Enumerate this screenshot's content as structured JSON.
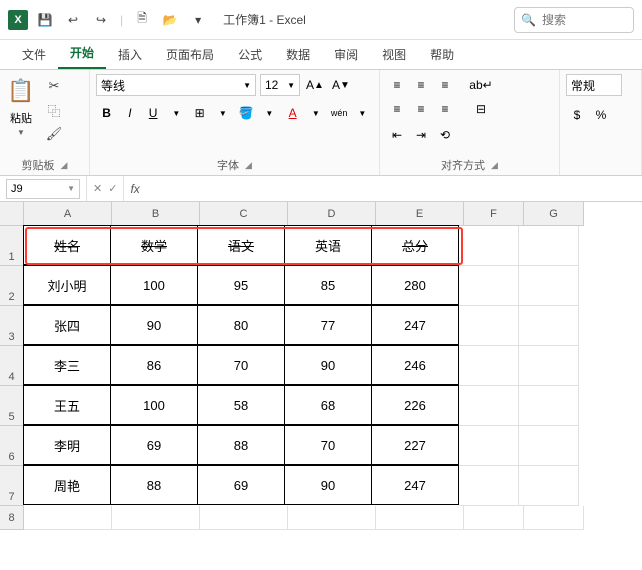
{
  "titlebar": {
    "title": "工作簿1 - Excel",
    "search_placeholder": "搜索"
  },
  "tabs": [
    "文件",
    "开始",
    "插入",
    "页面布局",
    "公式",
    "数据",
    "审阅",
    "视图",
    "帮助"
  ],
  "active_tab": 1,
  "ribbon": {
    "clipboard": {
      "paste": "粘贴",
      "label": "剪贴板"
    },
    "font": {
      "name": "等线",
      "size": "12",
      "label": "字体"
    },
    "align": {
      "label": "对齐方式"
    },
    "number": {
      "format": "常规"
    }
  },
  "name_box": "J9",
  "columns": [
    "A",
    "B",
    "C",
    "D",
    "E",
    "F",
    "G"
  ],
  "rows": [
    "1",
    "2",
    "3",
    "4",
    "5",
    "6",
    "7",
    "8"
  ],
  "table": {
    "headers": [
      "姓名",
      "数学",
      "语文",
      "英语",
      "总分"
    ],
    "data": [
      [
        "刘小明",
        "100",
        "95",
        "85",
        "280"
      ],
      [
        "张四",
        "90",
        "80",
        "77",
        "247"
      ],
      [
        "李三",
        "86",
        "70",
        "90",
        "246"
      ],
      [
        "王五",
        "100",
        "58",
        "68",
        "226"
      ],
      [
        "李明",
        "69",
        "88",
        "70",
        "227"
      ],
      [
        "周艳",
        "88",
        "69",
        "90",
        "247"
      ]
    ]
  },
  "chart_data": {
    "type": "table",
    "columns": [
      "姓名",
      "数学",
      "语文",
      "英语",
      "总分"
    ],
    "rows": [
      {
        "姓名": "刘小明",
        "数学": 100,
        "语文": 95,
        "英语": 85,
        "总分": 280
      },
      {
        "姓名": "张四",
        "数学": 90,
        "语文": 80,
        "英语": 77,
        "总分": 247
      },
      {
        "姓名": "李三",
        "数学": 86,
        "语文": 70,
        "英语": 90,
        "总分": 246
      },
      {
        "姓名": "王五",
        "数学": 100,
        "语文": 58,
        "英语": 68,
        "总分": 226
      },
      {
        "姓名": "李明",
        "数学": 69,
        "语文": 88,
        "英语": 70,
        "总分": 227
      },
      {
        "姓名": "周艳",
        "数学": 88,
        "语文": 69,
        "英语": 90,
        "总分": 247
      }
    ]
  }
}
